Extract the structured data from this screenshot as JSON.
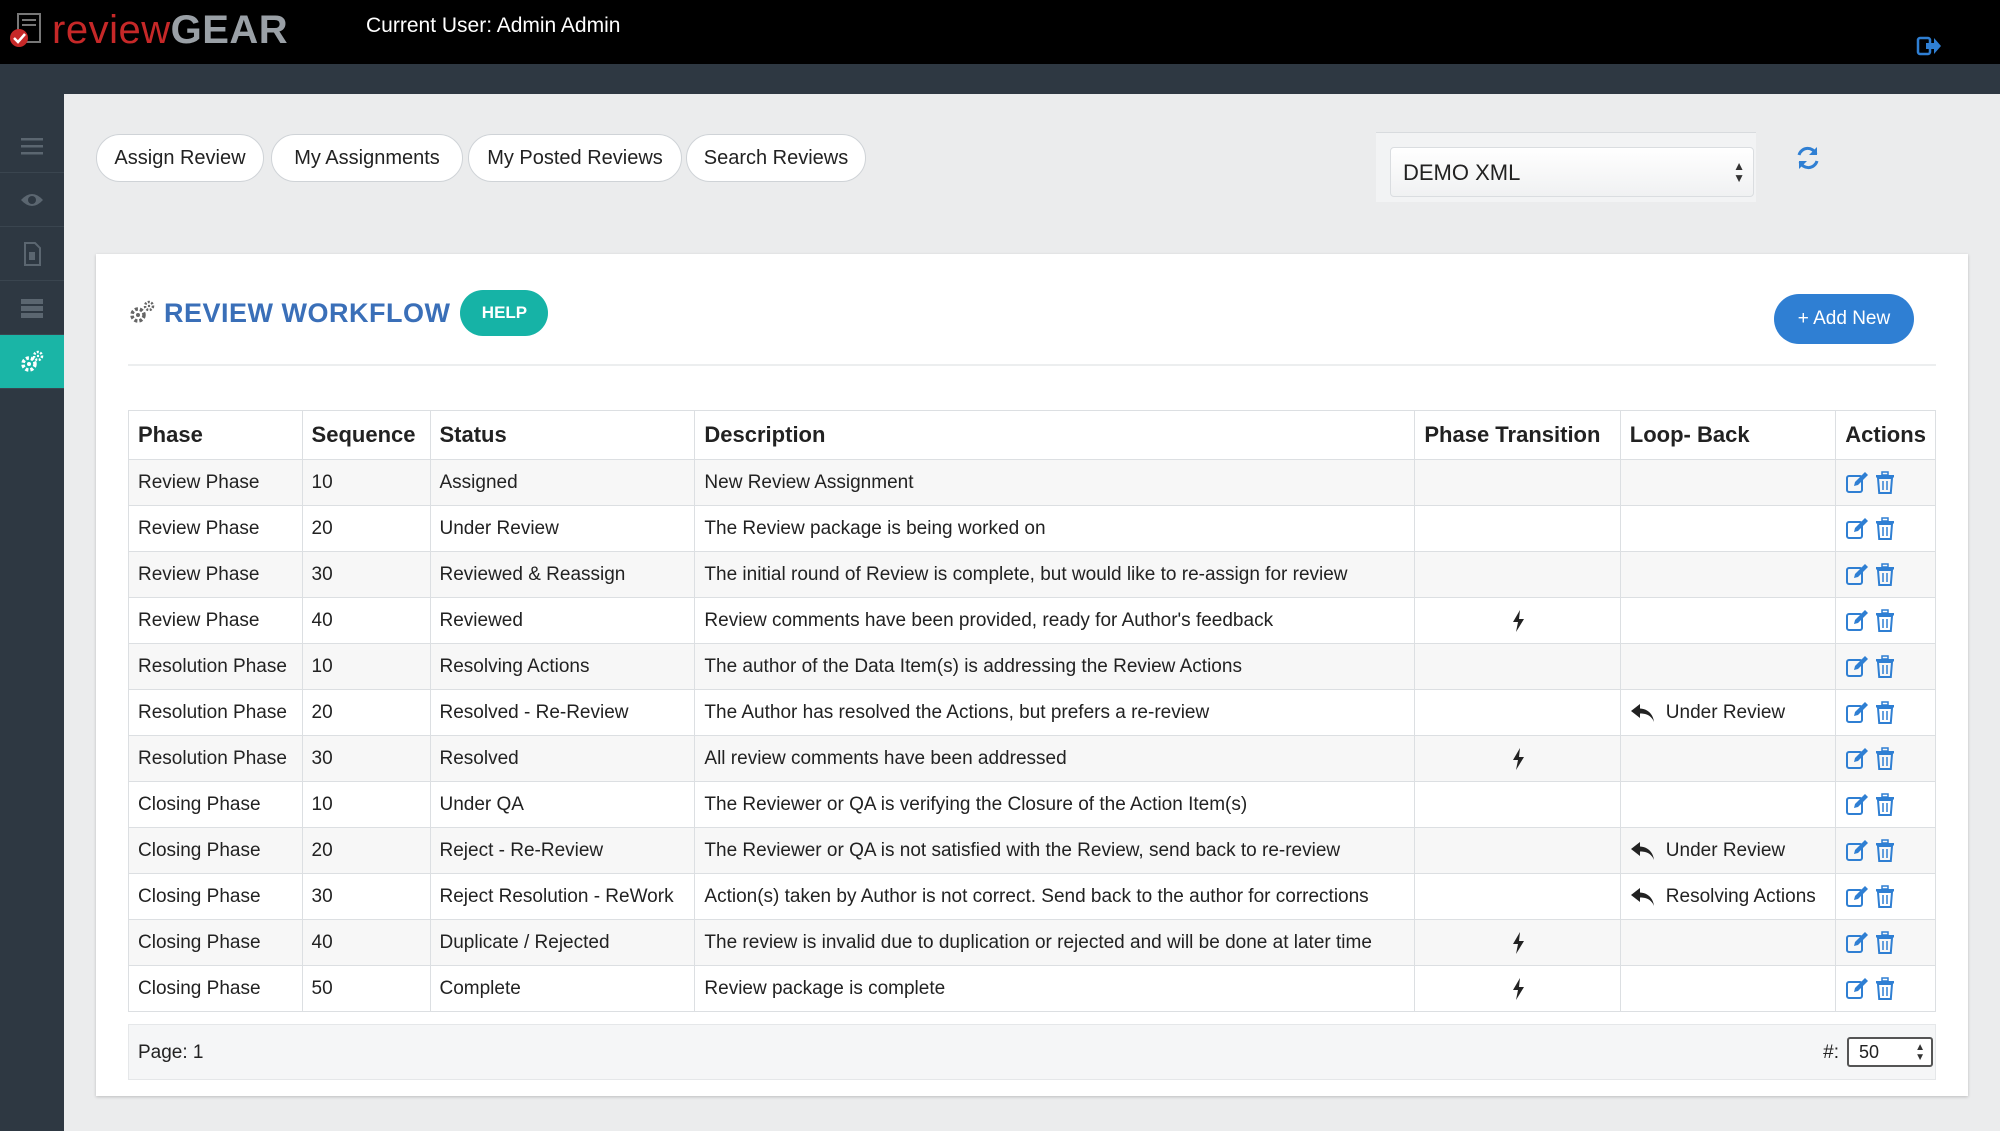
{
  "app": {
    "logo_part1": "review",
    "logo_part2": "GEAR",
    "current_user": "Current User: Admin Admin"
  },
  "tabs": [
    {
      "label": "Assign Review"
    },
    {
      "label": "My Assignments"
    },
    {
      "label": "My Posted Reviews"
    },
    {
      "label": "Search Reviews"
    }
  ],
  "project_select": {
    "value": "DEMO XML"
  },
  "panel": {
    "title": "REVIEW WORKFLOW",
    "help_label": "HELP",
    "add_new_label": "+ Add New"
  },
  "table": {
    "columns": [
      "Phase",
      "Sequence",
      "Status",
      "Description",
      "Phase Transition",
      "Loop- Back",
      "Actions"
    ],
    "rows": [
      {
        "phase": "Review Phase",
        "sequence": "10",
        "status": "Assigned",
        "description": "New Review Assignment",
        "transition": false,
        "loop_back": ""
      },
      {
        "phase": "Review Phase",
        "sequence": "20",
        "status": "Under Review",
        "description": "The Review package is being worked on",
        "transition": false,
        "loop_back": ""
      },
      {
        "phase": "Review Phase",
        "sequence": "30",
        "status": "Reviewed & Reassign",
        "description": "The initial round of Review is complete, but would like to re-assign for review",
        "transition": false,
        "loop_back": ""
      },
      {
        "phase": "Review Phase",
        "sequence": "40",
        "status": "Reviewed",
        "description": "Review comments have been provided, ready for Author's feedback",
        "transition": true,
        "loop_back": ""
      },
      {
        "phase": "Resolution Phase",
        "sequence": "10",
        "status": "Resolving Actions",
        "description": "The author of the Data Item(s) is addressing the Review Actions",
        "transition": false,
        "loop_back": ""
      },
      {
        "phase": "Resolution Phase",
        "sequence": "20",
        "status": "Resolved - Re-Review",
        "description": "The Author has resolved the Actions, but prefers a re-review",
        "transition": false,
        "loop_back": "Under Review"
      },
      {
        "phase": "Resolution Phase",
        "sequence": "30",
        "status": "Resolved",
        "description": "All review comments have been addressed",
        "transition": true,
        "loop_back": ""
      },
      {
        "phase": "Closing Phase",
        "sequence": "10",
        "status": "Under QA",
        "description": "The Reviewer or QA is verifying the Closure of the Action Item(s)",
        "transition": false,
        "loop_back": ""
      },
      {
        "phase": "Closing Phase",
        "sequence": "20",
        "status": "Reject - Re-Review",
        "description": "The Reviewer or QA is not satisfied with the Review, send back to re-review",
        "transition": false,
        "loop_back": "Under Review"
      },
      {
        "phase": "Closing Phase",
        "sequence": "30",
        "status": "Reject Resolution - ReWork",
        "description": "Action(s) taken by Author is not correct. Send back to the author for corrections",
        "transition": false,
        "loop_back": "Resolving Actions"
      },
      {
        "phase": "Closing Phase",
        "sequence": "40",
        "status": "Duplicate / Rejected",
        "description": "The review is invalid due to duplication or rejected and will be done at later time",
        "transition": true,
        "loop_back": ""
      },
      {
        "phase": "Closing Phase",
        "sequence": "50",
        "status": "Complete",
        "description": "Review package is complete",
        "transition": true,
        "loop_back": ""
      }
    ]
  },
  "footer": {
    "page_label": "Page:  1",
    "per_page_label": "#:",
    "per_page_value": "50"
  },
  "icons": {
    "logo": "document-check-icon",
    "logout": "sign-out-icon",
    "refresh": "refresh-icon",
    "rail": [
      "menu-icon",
      "eye-icon",
      "file-icon",
      "list-icon",
      "gears-icon"
    ],
    "transition": "bolt-icon",
    "loop_back": "reply-icon",
    "edit": "edit-icon",
    "delete": "trash-icon"
  },
  "colors": {
    "accent_teal": "#16b3a6",
    "title_blue": "#3a6fb8",
    "button_blue": "#2f7fd3",
    "icon_blue": "#2f7fd3",
    "logo_red": "#c62828"
  }
}
